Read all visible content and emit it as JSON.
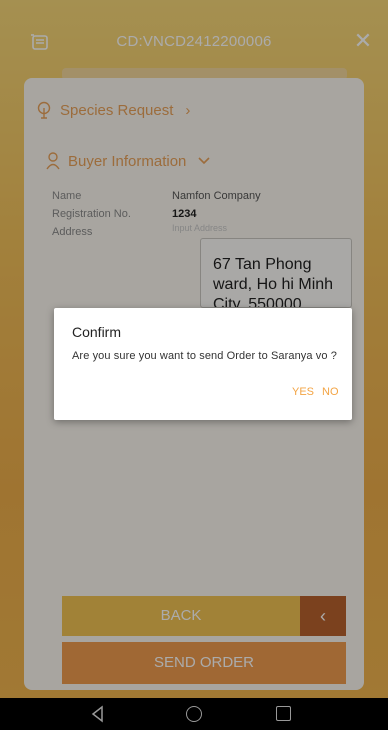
{
  "header": {
    "title": "CD:VNCD2412200006",
    "close_glyph": "✕"
  },
  "sections": {
    "species_label": "Species Request",
    "species_chevron": "›",
    "buyer_label": "Buyer Information"
  },
  "buyer": {
    "name_label": "Name",
    "name_value": "Namfon Company",
    "registration_label": "Registration No.",
    "registration_value": "1234",
    "address_label": "Address",
    "address_placeholder": "Input Address",
    "address_value": "67 Tan Phong ward, Ho hi Minh City, 550000, Vietnam"
  },
  "buttons": {
    "back": "BACK",
    "back_arrow": "‹",
    "send_order": "SEND ORDER"
  },
  "dialog": {
    "title": "Confirm",
    "message": "Are you sure you want to send Order to Saranya vo ?",
    "yes": "YES",
    "no": "NO"
  },
  "icons": {
    "cart": "cart-icon",
    "close": "close-icon",
    "species": "plant-icon",
    "buyer": "person-icon",
    "expand": "chevron-down-icon"
  },
  "colors": {
    "accent": "#e9a25a",
    "back_button": "#f1c253",
    "send_button": "#ef9c4e",
    "dialog_action": "#f3a444"
  }
}
